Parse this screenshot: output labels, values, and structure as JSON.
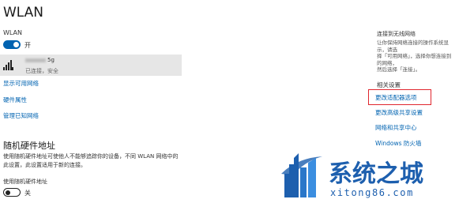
{
  "page": {
    "title": "WLAN",
    "wlan_toggle_label": "WLAN",
    "wlan_toggle_state": "开"
  },
  "network": {
    "ssid_suffix": "5g",
    "status": "已连接，安全"
  },
  "links": {
    "show_available": "显示可用网络",
    "hardware_props": "硬件属性",
    "manage_known": "管理已知网络"
  },
  "random_hw": {
    "title": "随机硬件地址",
    "desc_line1": "使用随机硬件地址可使他人不能够追踪你的设备，不同 WLAN 网络中的",
    "desc_line2": "此设置，此设置适用于新的连接。",
    "toggle_label": "使用随机硬件地址",
    "toggle_state": "关"
  },
  "right": {
    "head": "连接到无线网络",
    "desc_lines": [
      "让你保持网络连接的操作系统显示，请选",
      "择「可用网络」，选择你想连接到的网络，",
      "然后选择「连接」。"
    ],
    "related_head": "相关设置",
    "related_links": [
      "更改适配器选项",
      "更改高级共享设置",
      "网络和共享中心",
      "Windows 防火墙"
    ]
  },
  "watermark": {
    "brand_cn": "系统之城",
    "brand_url": "xitong86.com"
  },
  "colors": {
    "accent": "#0063b1",
    "highlight_border": "#e0262e"
  }
}
